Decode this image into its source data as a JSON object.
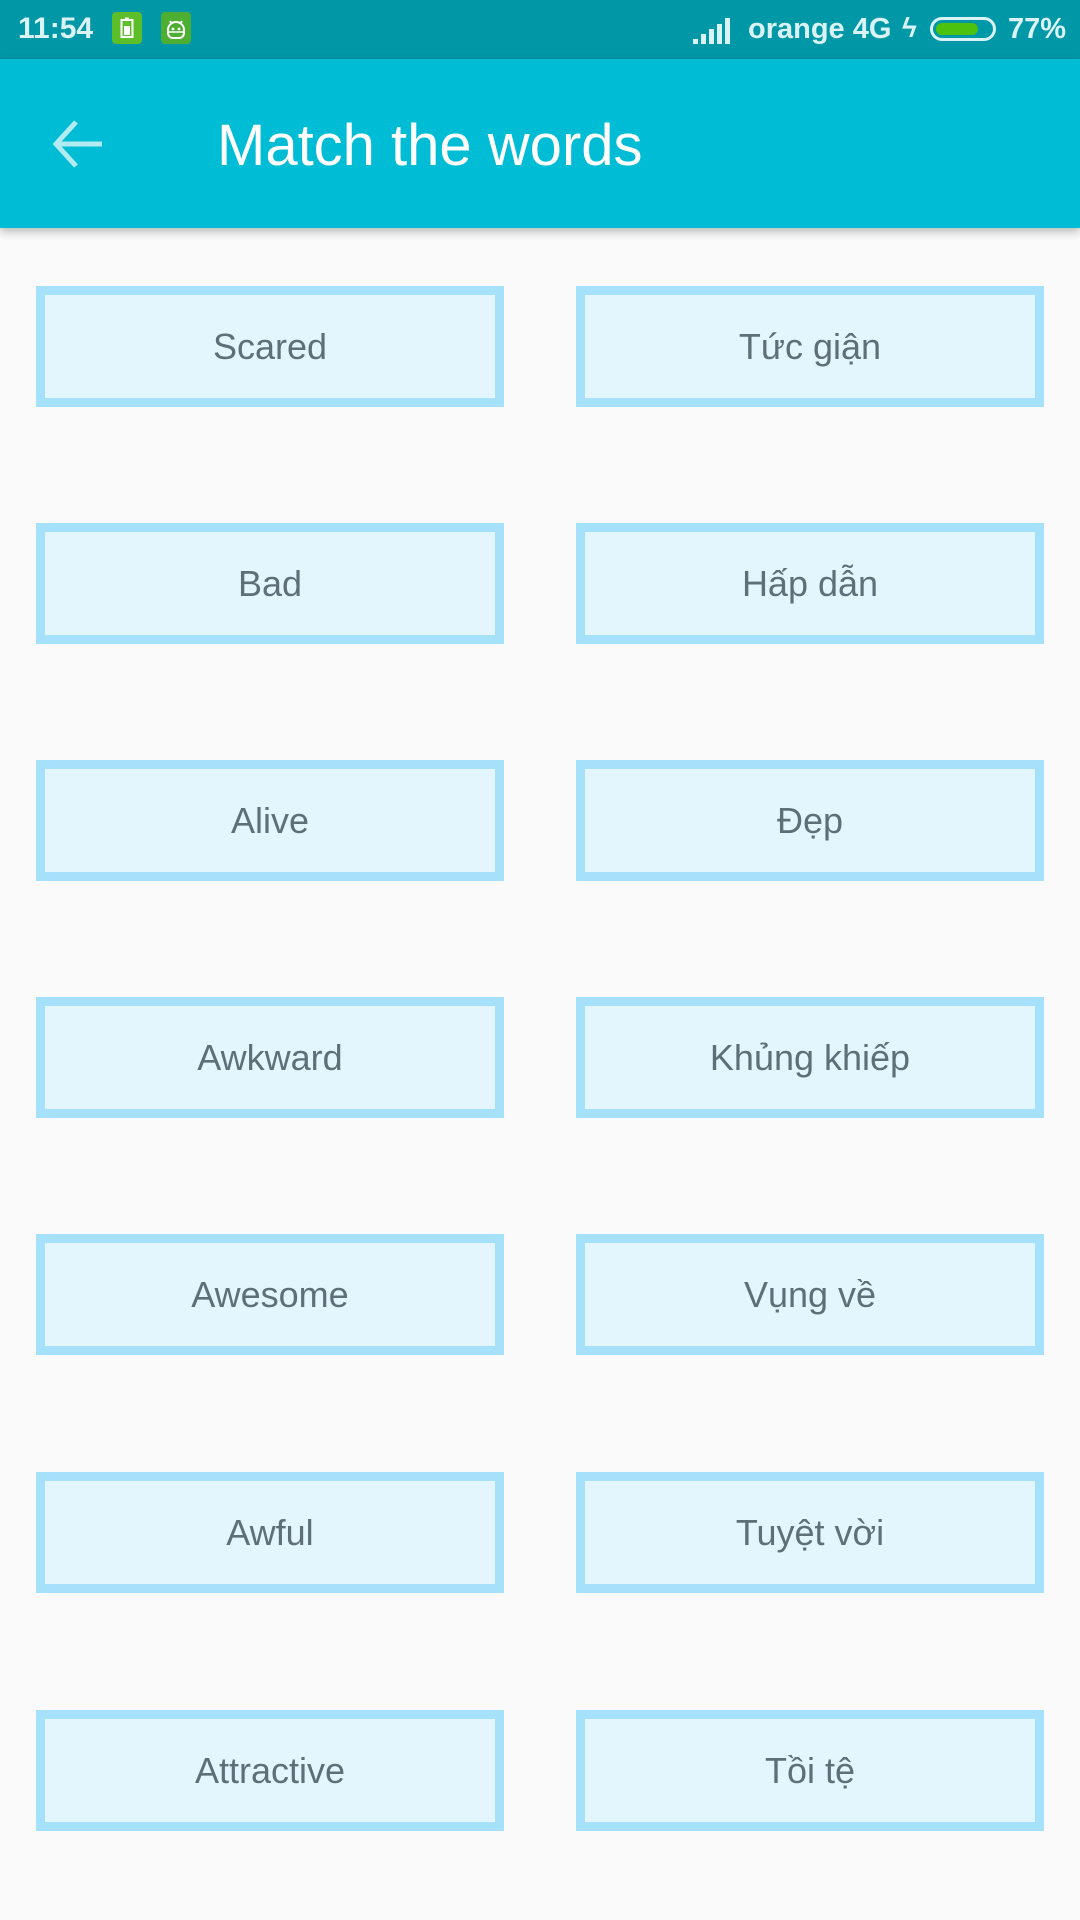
{
  "status_bar": {
    "time": "11:54",
    "notification_icons": [
      "battery-saver-icon",
      "android-icon"
    ],
    "carrier": "orange 4G",
    "charging": true,
    "battery_percent": "77%",
    "battery_level": 0.77
  },
  "toolbar": {
    "back_icon": "arrow-left-icon",
    "title": "Match the words"
  },
  "colors": {
    "status_bar": "#0097a7",
    "toolbar": "#00bcd4",
    "tile_border": "#a6e1fb",
    "tile_fill": "#e3f5fd",
    "tile_text": "#5f6f78",
    "background": "#fafafa"
  },
  "english_words": [
    "Scared",
    "Bad",
    "Alive",
    "Awkward",
    "Awesome",
    "Awful",
    "Attractive"
  ],
  "vietnamese_words": [
    "Tức giận",
    "Hấp dẫn",
    "Đẹp",
    "Khủng khiếp",
    "Vụng về",
    "Tuyệt vời",
    "Tồi tệ"
  ]
}
